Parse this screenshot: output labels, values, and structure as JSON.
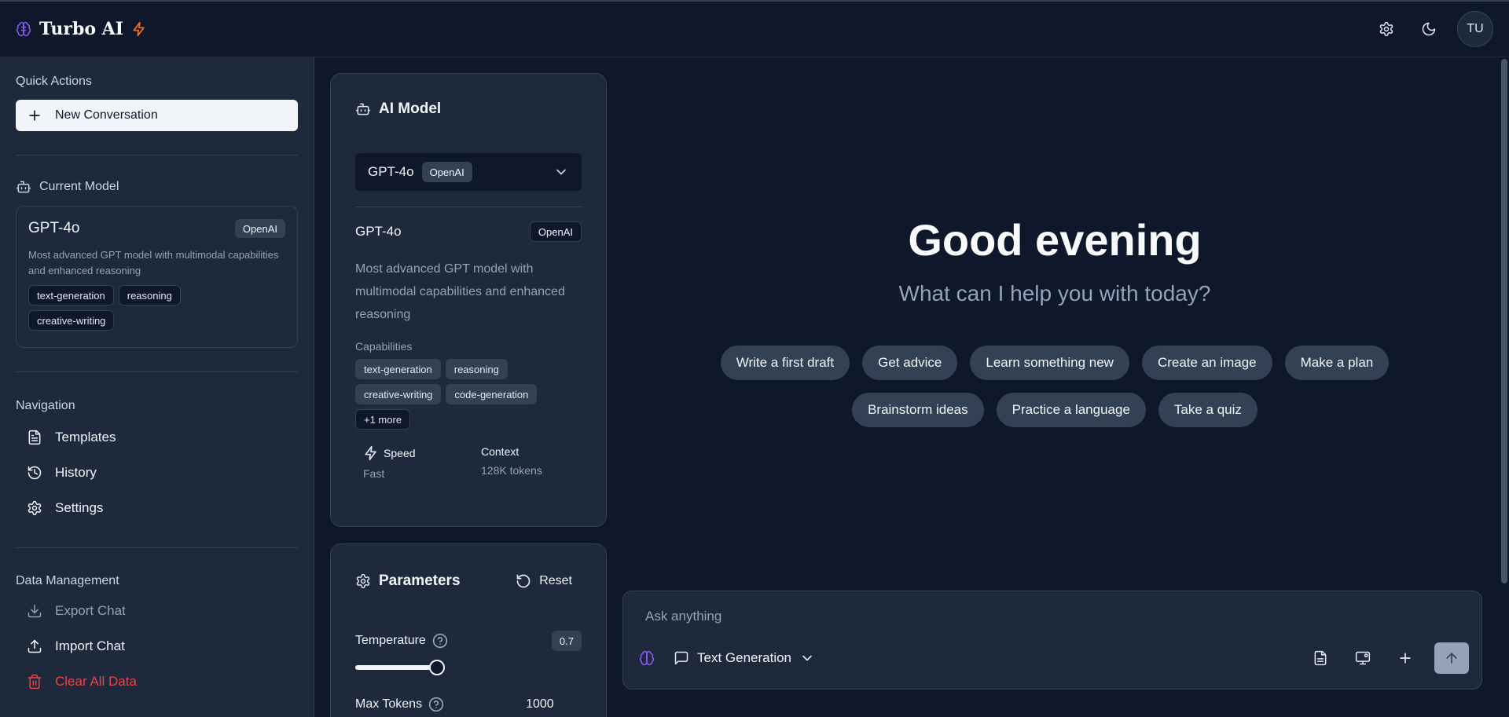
{
  "header": {
    "app_name": "Turbo AI",
    "avatar_initials": "TU",
    "icons": [
      "brain-icon",
      "lightning-icon",
      "settings-icon",
      "moon-icon"
    ]
  },
  "sidebar": {
    "quick_actions_label": "Quick Actions",
    "new_conversation_label": "New Conversation",
    "current_model_label": "Current Model",
    "model": {
      "name": "GPT-4o",
      "provider": "OpenAI",
      "description": "Most advanced GPT model with multimodal capabilities and enhanced reasoning",
      "tags": [
        "text-generation",
        "reasoning",
        "creative-writing"
      ]
    },
    "navigation_label": "Navigation",
    "nav_items": [
      {
        "label": "Templates",
        "icon": "document-icon"
      },
      {
        "label": "History",
        "icon": "history-icon"
      },
      {
        "label": "Settings",
        "icon": "gear-icon"
      }
    ],
    "data_management_label": "Data Management",
    "data_items": [
      {
        "label": "Export Chat",
        "icon": "download-icon"
      },
      {
        "label": "Import Chat",
        "icon": "upload-icon"
      },
      {
        "label": "Clear All Data",
        "icon": "trash-icon"
      }
    ]
  },
  "model_panel": {
    "title": "AI Model",
    "selected_model": "GPT-4o",
    "selected_provider": "OpenAI",
    "model_name": "GPT-4o",
    "provider": "OpenAI",
    "description": "Most advanced GPT model with multimodal capabilities and enhanced reasoning",
    "capabilities_label": "Capabilities",
    "capabilities": [
      "text-generation",
      "reasoning",
      "creative-writing",
      "code-generation"
    ],
    "more_label": "+1 more",
    "speed_label": "Speed",
    "speed_value": "Fast",
    "context_label": "Context",
    "context_value": "128K tokens"
  },
  "params_panel": {
    "title": "Parameters",
    "reset_label": "Reset",
    "temperature_label": "Temperature",
    "temperature_value": "0.7",
    "temperature_fraction": 0.35,
    "max_tokens_label": "Max Tokens",
    "max_tokens_value": "1000"
  },
  "main": {
    "greeting": "Good evening",
    "subtitle": "What can I help you with today?",
    "suggestions_row1": [
      "Write a first draft",
      "Get advice",
      "Learn something new",
      "Create an image",
      "Make a plan"
    ],
    "suggestions_row2": [
      "Brainstorm ideas",
      "Practice a language",
      "Take a quiz"
    ]
  },
  "composer": {
    "placeholder": "Ask anything",
    "mode_label": "Text Generation"
  },
  "colors": {
    "background": "#0f172a",
    "panel": "#1e293b",
    "border": "#334155",
    "accent": "#8b5cf6",
    "lightning": "#f97316",
    "danger": "#ef4444"
  }
}
